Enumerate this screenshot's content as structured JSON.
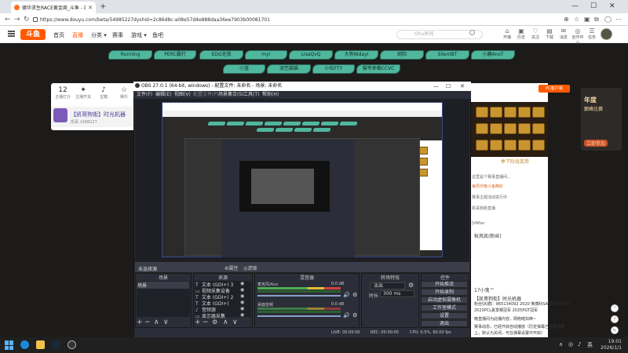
{
  "browser": {
    "tab_title": "德华求生RACE黄金周_斗鱼 - 凯...",
    "url": "https://www.douyu.com/beta/54985227dyshid=2c86d8c-a08e57d4e888daa36ee7903b00081701",
    "window_controls": [
      "—",
      "☐",
      "✕"
    ],
    "new_tab": "+"
  },
  "douyu_header": {
    "logo": "斗鱼",
    "nav": [
      "首页",
      "直播",
      "分类 ▾",
      "赛事",
      "游戏 ▾",
      "鱼吧"
    ],
    "search_placeholder": "Ohu房间",
    "user_icons": [
      {
        "glyph": "⌂",
        "label": "开播"
      },
      {
        "glyph": "▣",
        "label": "历史"
      },
      {
        "glyph": "♡",
        "label": "关注"
      },
      {
        "glyph": "▤",
        "label": "下载"
      },
      {
        "glyph": "✉",
        "label": "消息"
      },
      {
        "glyph": "◎",
        "label": "创作中心"
      },
      {
        "glyph": "☰",
        "label": "任务"
      }
    ]
  },
  "leaves_row1": [
    "Running",
    "PERC霸打",
    "EDG无我",
    "my!",
    "LisaQvQ",
    "大狗Nidayi",
    "胡阳",
    "SilentBT",
    "小磨AnxT"
  ],
  "leaves_row2": [
    "小蓝",
    "泥巴猫猫",
    "小伍FTY",
    "猫爷来嘞CCVC"
  ],
  "room": {
    "stats": [
      {
        "n": "12",
        "t": "主播打分"
      },
      {
        "n": "✦",
        "t": "主播开关"
      },
      {
        "n": "♪",
        "t": "宝箱"
      },
      {
        "n": "☆",
        "t": "娱乐"
      }
    ],
    "title": "【凯哥狗街】时光机器",
    "sub": "凯哥   1488227"
  },
  "right_panel": {
    "pc_label": "PC客户端",
    "gold_label": "季下阶段奖券",
    "chat": [
      "这里是个赛事直播间...",
      "每周日晚斗鱼精彩",
      "赛事主题活动进行中",
      "凯哥狗街直播",
      "JVAfter"
    ],
    "lower_text": [
      "秋风凯(粉丝)",
      "17小鬼™",
      "【凯哥狗街】时光机器",
      "粉丝QQ群：865134092 2020 微博科SA冠军 2023F",
      "2023PCL夏季赛冠军 2025PGT冠军",
      "晚直播间为此播内容，网络暗扣唤~",
      "赛事动态，已经开启自动播放（历史弹幕已在播放器",
      "上，默认为关闭，可在弹幕设置中开启）"
    ]
  },
  "ad": {
    "lines": [
      "年度",
      "巅峰比赛",
      "立即参加"
    ]
  },
  "obs": {
    "title": "OBS 27.0.1 (64-bit, windows) - 配置文件: 未命名 - 场景: 未命名",
    "menu": [
      "文件(F)",
      "编辑(E)",
      "视图(V)",
      "配置文件(P)",
      "场景集合(S)",
      "工具(T)",
      "帮助(H)"
    ],
    "source_toolbar": {
      "label": "未选择源",
      "props": "⚙属性",
      "filters": "◎滤镜"
    },
    "docks": {
      "scenes": {
        "title": "场景",
        "items": [
          "场景"
        ]
      },
      "sources": {
        "title": "来源",
        "items": [
          {
            "icon": "T",
            "label": "文本 (GDI+) 3"
          },
          {
            "icon": "▭",
            "label": "视频采集设备"
          },
          {
            "icon": "T",
            "label": "文本 (GDI+) 2"
          },
          {
            "icon": "T",
            "label": "文本 (GDI+)"
          },
          {
            "icon": "♪",
            "label": "音频源"
          },
          {
            "icon": "▭",
            "label": "显示器采集"
          }
        ]
      },
      "mixer": {
        "title": "混音器",
        "channels": [
          {
            "name": "麦克风/Aux",
            "db": "0.0 dB"
          },
          {
            "name": "桌面音频",
            "db": "0.0 dB"
          }
        ]
      },
      "transitions": {
        "title": "转场特效",
        "type": "淡出",
        "duration_label": "时长",
        "duration": "300 ms"
      },
      "controls": {
        "title": "控件",
        "buttons": [
          "开始推流",
          "开始录制",
          "启动虚拟摄像机",
          "工作室模式",
          "设置",
          "退出"
        ]
      }
    },
    "footer_buttons": [
      "+",
      "−",
      "∧",
      "∨"
    ],
    "status": {
      "live": "LIVE: 00:00:00",
      "rec": "REC: 00:00:00",
      "cpu": "CPU: 0.5%, 60.00 fps"
    }
  },
  "taskbar": {
    "time": "19:01",
    "date": "2026/1/1",
    "lang": "英"
  }
}
